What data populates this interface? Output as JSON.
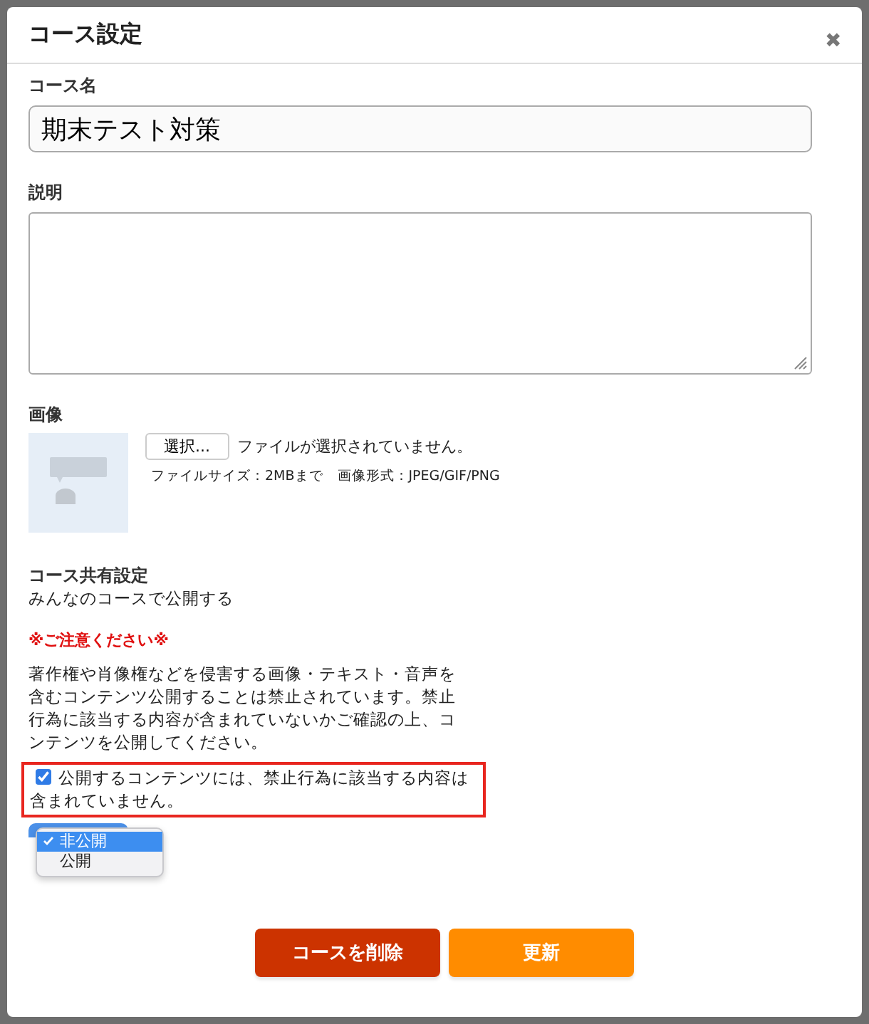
{
  "dialog": {
    "title": "コース設定",
    "close": "✖"
  },
  "name_field": {
    "label": "コース名",
    "value": "期末テスト対策"
  },
  "description_field": {
    "label": "説明"
  },
  "image": {
    "label": "画像",
    "choose_button": "選択...",
    "file_status": "ファイルが選択されていません。",
    "hint": "ファイルサイズ：2MBまで　画像形式：JPEG/GIF/PNG"
  },
  "sharing": {
    "label": "コース共有設定",
    "option_text": "みんなのコースで公開する"
  },
  "notice": {
    "heading": "※ご注意ください※",
    "body": "著作権や肖像権などを侵害する画像・テキスト・音声を含むコンテンツ公開することは禁止されています。禁止行為に該当する内容が含まれていないかご確認の上、コンテンツを公開してください。"
  },
  "confirm": {
    "label": "公開するコンテンツには、禁止行為に該当する内容は含まれていません。",
    "checked": true
  },
  "visibility_menu": {
    "options": [
      {
        "label": "非公開",
        "selected": true
      },
      {
        "label": "公開",
        "selected": false
      }
    ]
  },
  "buttons": [
    {
      "label": "コースを削除",
      "kind": "danger"
    },
    {
      "label": "更新",
      "kind": "primary"
    }
  ]
}
